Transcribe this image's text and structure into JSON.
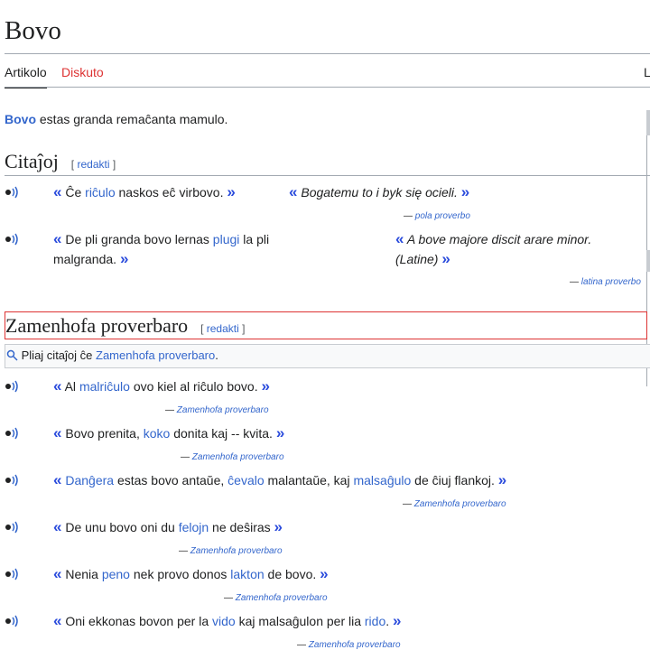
{
  "page": {
    "title": "Bovo"
  },
  "tabs": {
    "article": "Artikolo",
    "discuss": "Diskuto",
    "right_cut": "L"
  },
  "intro": {
    "bold": "Bovo",
    "rest": " estas granda remaĉanta mamulo."
  },
  "edit_label": {
    "open": "[",
    "link": "redakti",
    "close": "]"
  },
  "section1": {
    "heading": "Citaĵoj",
    "quotes": [
      {
        "open": "«",
        "parts": [
          "Ĉe ",
          "riĉulo",
          " naskos eĉ virbovo. "
        ],
        "close": "»",
        "trans_open": "«",
        "trans": " Bogatemu to i byk się ocieli. ",
        "trans_close": "»",
        "dash": "—",
        "source": "pola proverbo"
      },
      {
        "open": "«",
        "parts_line1": [
          " De pli granda bovo lernas ",
          "plugi",
          " la pli"
        ],
        "parts_line2": "malgranda. ",
        "close": "»",
        "trans_open": "«",
        "trans_line1": " A bove majore discit arare minor.",
        "trans_line2": "(Latine) ",
        "trans_close": "»",
        "dash": "—",
        "source": "latina proverbo"
      }
    ]
  },
  "section2": {
    "heading": "Zamenhofa proverbaro",
    "search_text": "Pliaj citaĵoj ĉe ",
    "search_link": "Zamenhofa proverbaro",
    "search_end": ".",
    "quotes": [
      {
        "pre": " Al ",
        "link": "malriĉulo",
        "post": " ovo kiel al riĉulo bovo. ",
        "source": "Zamenhofa proverbaro"
      },
      {
        "pre": " Bovo prenita, ",
        "link": "koko",
        "post": " donita kaj -- kvita. ",
        "source": "Zamenhofa proverbaro"
      },
      {
        "pre": " ",
        "link": "Danĝera",
        "mid1": " estas bovo antaŭe, ",
        "link2": "ĉevalo",
        "mid2": " malantaŭe, kaj ",
        "link3": "malsaĝulo",
        "post": " de ĉiuj flankoj. ",
        "source": "Zamenhofa proverbaro"
      },
      {
        "pre": " De unu bovo oni du ",
        "link": "felojn",
        "post": " ne deŝiras ",
        "source": "Zamenhofa proverbaro"
      },
      {
        "pre": " Nenia ",
        "link": "peno",
        "mid1": " nek provo donos ",
        "link2": "lakton",
        "post": " de bovo. ",
        "source": "Zamenhofa proverbaro"
      },
      {
        "pre": " Oni ekkonas bovon per la ",
        "link": "vido",
        "mid1": " kaj malsaĝulon per lia ",
        "link2": "rido",
        "post": ". ",
        "source": "Zamenhofa proverbaro"
      }
    ],
    "open": "«",
    "close": "»",
    "dash": "—"
  },
  "icons": {
    "speaker": "speaker-icon",
    "search": "search-icon"
  },
  "colors": {
    "link": "#3366cc",
    "quote_mark": "#2a4bdc",
    "red_link": "#d33",
    "border": "#a2a9b1"
  }
}
